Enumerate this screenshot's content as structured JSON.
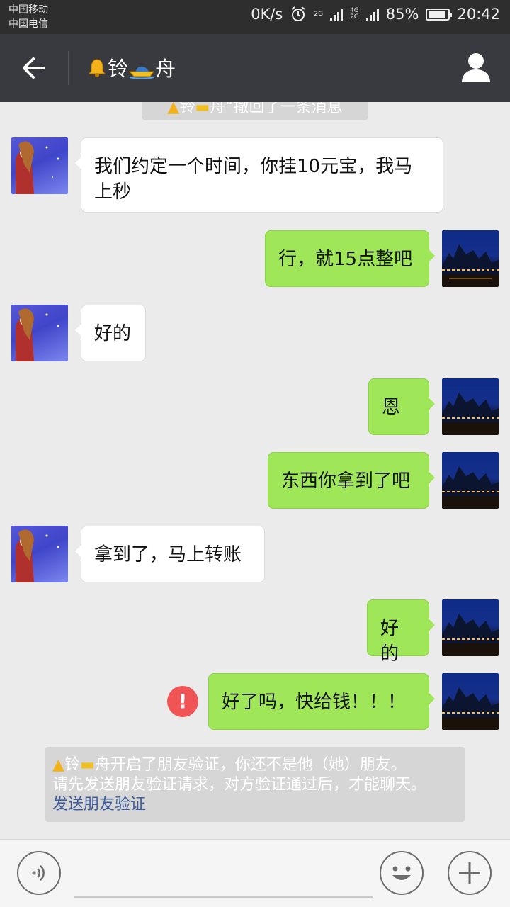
{
  "status_bar": {
    "carrier_1": "中国移动",
    "carrier_2": "中国电信",
    "net_speed": "0K/s",
    "sim_1_type": "2G",
    "sim_2_type_top": "4G",
    "sim_2_type_bottom": "2G",
    "battery": "85%",
    "battery_level": 0.85,
    "time": "20:42",
    "icons": [
      "alarm-icon",
      "signal-icon",
      "battery-icon"
    ]
  },
  "header": {
    "title_part1": "铃",
    "title_part2": "舟",
    "left_icon": "back-arrow-icon",
    "right_icon": "user-profile-icon",
    "title_icons": [
      "bell-emoji",
      "speedboat-emoji"
    ]
  },
  "recall_notice": {
    "name_part1": "铃",
    "name_part2": "舟",
    "text": "撤回了一条消息"
  },
  "messages": [
    {
      "side": "left",
      "text": "我们约定一个时间，你挂10元宝，我马上秒"
    },
    {
      "side": "right",
      "text": "行，就15点整吧"
    },
    {
      "side": "left",
      "text": "好的"
    },
    {
      "side": "right",
      "text": "恩"
    },
    {
      "side": "right",
      "text": "东西你拿到了吧"
    },
    {
      "side": "left",
      "text": "拿到了，马上转账"
    },
    {
      "side": "right",
      "text": "好的"
    },
    {
      "side": "right",
      "text": "好了吗，快给钱！！！",
      "failed": true,
      "failed_icon": "!"
    }
  ],
  "system_note": {
    "name_part1": "铃",
    "name_part2": "舟",
    "line1_suffix": "开启了朋友验证，你还不是他（她）朋友。",
    "line2": "请先发送朋友验证请求，对方验证通过后，才能聊天。",
    "link": "发送朋友验证"
  },
  "input_bar": {
    "placeholder": "",
    "icons": [
      "voice-icon",
      "emoji-icon",
      "plus-icon"
    ]
  },
  "colors": {
    "title_bar": "#393a3f",
    "status_bar": "#2e2e2e",
    "chat_bg": "#ebebeb",
    "bubble_self": "#9fe658",
    "bubble_other": "#ffffff",
    "error": "#f05454",
    "link": "#3e5c99"
  }
}
